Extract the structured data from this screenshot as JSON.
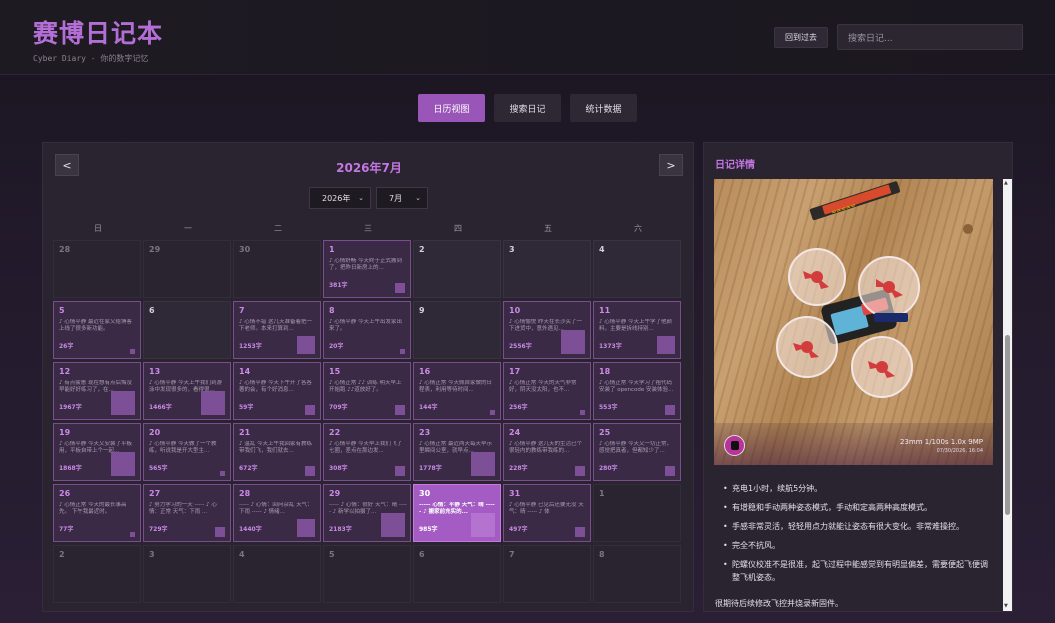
{
  "header": {
    "title": "赛博日记本",
    "subtitle": "Cyber Diary - 你的数字记忆",
    "back_button": "回到过去",
    "search_placeholder": "搜索日记..."
  },
  "tabs": [
    {
      "label": "日历视图",
      "active": true
    },
    {
      "label": "搜索日记",
      "active": false
    },
    {
      "label": "统计数据",
      "active": false
    }
  ],
  "calendar": {
    "prev_label": "<",
    "next_label": ">",
    "month_title": "2026年7月",
    "year_select": "2026年",
    "month_select": "7月",
    "weekdays": [
      "日",
      "一",
      "二",
      "三",
      "四",
      "五",
      "六"
    ],
    "cells": [
      {
        "day": "28",
        "other": true
      },
      {
        "day": "29",
        "other": true
      },
      {
        "day": "30",
        "other": true
      },
      {
        "day": "1",
        "preview": "♪ 心情舒畅 今天终于正式搬到了，把昨日新房上的...",
        "count": "381字",
        "thumb": "s"
      },
      {
        "day": "2"
      },
      {
        "day": "3"
      },
      {
        "day": "4"
      },
      {
        "day": "5",
        "preview": "♪ 心情平静 最近在家又给博客上线了很多新功能。",
        "count": "26字",
        "thumb": "xs"
      },
      {
        "day": "6"
      },
      {
        "day": "7",
        "preview": "♪ 心情不错 这几天准备着把一下老师。本来打算到...",
        "count": "1253字",
        "thumb": "m"
      },
      {
        "day": "8",
        "preview": "♪ 心情平静 今天上午出发家出来了。",
        "count": "20字",
        "thumb": "xs"
      },
      {
        "day": "9"
      },
      {
        "day": "10",
        "preview": "♪ 心情愉悦 昨天在长沙买了一下进货中，意外遇见...",
        "count": "2556字",
        "thumb": "l"
      },
      {
        "day": "11",
        "preview": "♪ 心情平静 今天上午学了他颜料，主要是拆线持别...",
        "count": "1373字",
        "thumb": "m"
      },
      {
        "day": "12",
        "preview": "♪ 有点疲惫 现在想有点后悔没早能好好练习了，在...",
        "count": "1967字",
        "thumb": "l"
      },
      {
        "day": "13",
        "preview": "♪ 心情平静 今天上午我们到游泳中发现很多的，看得很...",
        "count": "1466字",
        "thumb": "l"
      },
      {
        "day": "14",
        "preview": "♪ 心情平静 今天下午开了各各著的会，有个好消息...",
        "count": "59字",
        "thumb": "s"
      },
      {
        "day": "15",
        "preview": "♪ 心情正常 ♪♪ 训练 明天早上开始跑 ♪♪道放好了。",
        "count": "709字",
        "thumb": "s"
      },
      {
        "day": "16",
        "preview": "♪ 心情正常 今天佩自家做的日程表，利用等待时间...",
        "count": "144字",
        "thumb": "xs"
      },
      {
        "day": "17",
        "preview": "♪ 心情正常 今天的天气非常好，阴天没太阳，也不...",
        "count": "256字",
        "thumb": "xs"
      },
      {
        "day": "18",
        "preview": "♪ 心情正常 今天学习了祖代码安装了 opencode 安装体验...",
        "count": "553字",
        "thumb": "s"
      },
      {
        "day": "19",
        "preview": "♪ 心情平静 今天又安装了平板用，平板自带上个一起...",
        "count": "1868字",
        "thumb": "l"
      },
      {
        "day": "20",
        "preview": "♪ 心情平静 今天做了一个教练，听说我是开大型主...",
        "count": "565字",
        "thumb": "xs"
      },
      {
        "day": "21",
        "preview": "♪ 温乱 今天上午我回家有教练带我们飞，我们就去...",
        "count": "672字",
        "thumb": "s"
      },
      {
        "day": "22",
        "preview": "♪ 心情平静 今天早上我们飞了七圈，差点在那边发...",
        "count": "308字",
        "thumb": "s"
      },
      {
        "day": "23",
        "preview": "♪ 心情正常 最近两天每天早示里瞬间公室，就早点...",
        "count": "1778字",
        "thumb": "l"
      },
      {
        "day": "24",
        "preview": "♪ 心情平静 这几天的生活已个很轻内的教练带我练的...",
        "count": "228字",
        "thumb": "s"
      },
      {
        "day": "25",
        "preview": "♪ 心情平静 今天又一切正常，感觉把真者，但都知少了...",
        "count": "280字",
        "thumb": "s"
      },
      {
        "day": "26",
        "preview": "♪ 心情正常 今天的最长事高先。 下午我最近时。",
        "count": "77字",
        "thumb": "xs"
      },
      {
        "day": "27",
        "preview": "♪ 努力学习的一天 ----- ♪ 心情：正常 天气：下雨 ...",
        "count": "729字",
        "thumb": "s"
      },
      {
        "day": "28",
        "preview": "----- ♪ 心情：回问杂乱 天气：下雨 ----- ♪ 情绪...",
        "count": "1440字",
        "thumb": "m"
      },
      {
        "day": "29",
        "preview": "----- ♪ 心情：很好 天气：晴 ----- ♪ 新学以拍摄了...",
        "count": "2183字",
        "thumb": "l"
      },
      {
        "day": "30",
        "preview": "----- 心情：平静 天气：晴 ----- ♪ 搬家前充实的...",
        "count": "985字",
        "today": true,
        "thumb": "l"
      },
      {
        "day": "31",
        "preview": "♪ 心情平静 已见后还要无没 天气：晴 ----- ♪ 体",
        "count": "497字",
        "thumb": "s"
      },
      {
        "day": "1",
        "other": true
      },
      {
        "day": "2",
        "other": true
      },
      {
        "day": "3",
        "other": true
      },
      {
        "day": "4",
        "other": true
      },
      {
        "day": "5",
        "other": true
      },
      {
        "day": "6",
        "other": true
      },
      {
        "day": "7",
        "other": true
      },
      {
        "day": "8",
        "other": true
      }
    ]
  },
  "detail": {
    "title": "日记详情",
    "photo_exif": "23mm 1/100s 1.0x 9MP",
    "photo_date": "07/30/2026, 16:04",
    "bullets": [
      "充电1小时，续航5分钟。",
      "有增稳和手动两种姿态模式，手动和定高两种高度模式。",
      "手感非常灵活，轻轻用点力就能让姿态有很大变化。非常难操控。",
      "完全不抗风。",
      "陀螺仪校准不是很准，起飞过程中能感觉到有明显偏差，需要便起飞便调整飞机姿态。"
    ],
    "footer": "很期待后续修改飞控并烧录新固件。"
  }
}
